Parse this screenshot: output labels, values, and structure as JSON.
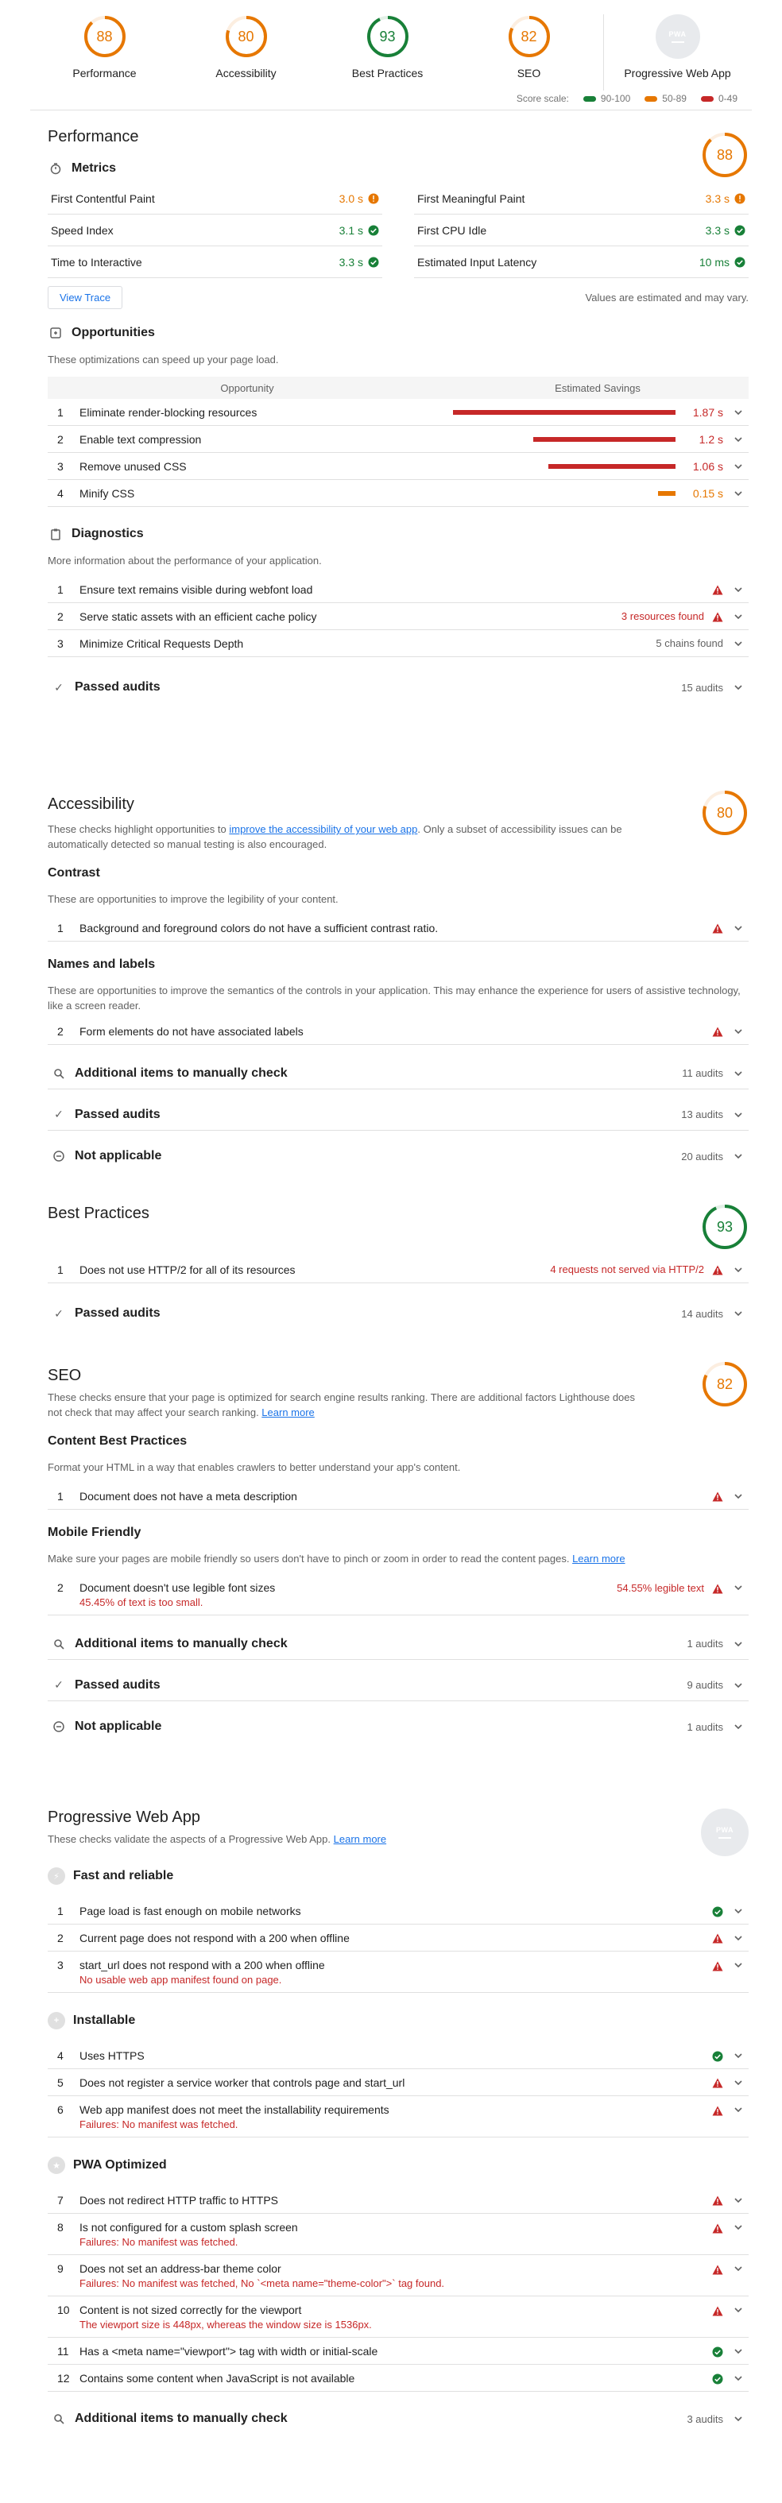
{
  "summary": {
    "categories": [
      {
        "label": "Performance",
        "score": "88",
        "value": 88,
        "color": "#e67700"
      },
      {
        "label": "Accessibility",
        "score": "80",
        "value": 80,
        "color": "#e67700"
      },
      {
        "label": "Best Practices",
        "score": "93",
        "value": 93,
        "color": "#188038"
      },
      {
        "label": "SEO",
        "score": "82",
        "value": 82,
        "color": "#e67700"
      }
    ],
    "pwa": {
      "label": "Progressive Web App",
      "badge": "PWA"
    },
    "scale_label": "Score scale:",
    "scale": [
      {
        "label": "90-100",
        "color": "#188038"
      },
      {
        "label": "50-89",
        "color": "#e67700"
      },
      {
        "label": "0-49",
        "color": "#c62828"
      }
    ]
  },
  "performance": {
    "title": "Performance",
    "score": "88",
    "metrics_title": "Metrics",
    "metrics_left": [
      {
        "label": "First Contentful Paint",
        "value": "3.0 s",
        "status": "average"
      },
      {
        "label": "Speed Index",
        "value": "3.1 s",
        "status": "pass"
      },
      {
        "label": "Time to Interactive",
        "value": "3.3 s",
        "status": "pass"
      }
    ],
    "metrics_right": [
      {
        "label": "First Meaningful Paint",
        "value": "3.3 s",
        "status": "average"
      },
      {
        "label": "First CPU Idle",
        "value": "3.3 s",
        "status": "pass"
      },
      {
        "label": "Estimated Input Latency",
        "value": "10 ms",
        "status": "pass"
      }
    ],
    "view_trace": "View Trace",
    "estimated_note": "Values are estimated and may vary.",
    "opportunities_title": "Opportunities",
    "opportunities_desc": "These optimizations can speed up your page load.",
    "opp_col_opportunity": "Opportunity",
    "opp_col_savings": "Estimated Savings",
    "opportunities": [
      {
        "num": "1",
        "title": "Eliminate render-blocking resources",
        "value": "1.87 s",
        "fraction": 1.0,
        "color": "#c62828"
      },
      {
        "num": "2",
        "title": "Enable text compression",
        "value": "1.2 s",
        "fraction": 0.64,
        "color": "#c62828"
      },
      {
        "num": "3",
        "title": "Remove unused CSS",
        "value": "1.06 s",
        "fraction": 0.57,
        "color": "#c62828"
      },
      {
        "num": "4",
        "title": "Minify CSS",
        "value": "0.15 s",
        "fraction": 0.08,
        "color": "#e67700"
      }
    ],
    "diagnostics_title": "Diagnostics",
    "diagnostics_desc": "More information about the performance of your application.",
    "diagnostics": [
      {
        "num": "1",
        "title": "Ensure text remains visible during webfont load",
        "detail": "",
        "warn": true
      },
      {
        "num": "2",
        "title": "Serve static assets with an efficient cache policy",
        "detail": "3 resources found",
        "warn": true
      },
      {
        "num": "3",
        "title": "Minimize Critical Requests Depth",
        "detail": "5 chains found",
        "warn": false
      }
    ],
    "passed_title": "Passed audits",
    "passed_count": "15 audits"
  },
  "accessibility": {
    "title": "Accessibility",
    "score": "80",
    "desc_pre": "These checks highlight opportunities to ",
    "desc_link": "improve the accessibility of your web app",
    "desc_post": ". Only a subset of accessibility issues can be automatically detected so manual testing is also encouraged.",
    "contrast_title": "Contrast",
    "contrast_desc": "These are opportunities to improve the legibility of your content.",
    "contrast_item": {
      "num": "1",
      "title": "Background and foreground colors do not have a sufficient contrast ratio."
    },
    "names_title": "Names and labels",
    "names_desc": "These are opportunities to improve the semantics of the controls in your application. This may enhance the experience for users of assistive technology, like a screen reader.",
    "names_item": {
      "num": "2",
      "title": "Form elements do not have associated labels"
    },
    "manual_title": "Additional items to manually check",
    "manual_count": "11 audits",
    "passed_title": "Passed audits",
    "passed_count": "13 audits",
    "na_title": "Not applicable",
    "na_count": "20 audits"
  },
  "best_practices": {
    "title": "Best Practices",
    "score": "93",
    "item": {
      "num": "1",
      "title": "Does not use HTTP/2 for all of its resources",
      "detail": "4 requests not served via HTTP/2"
    },
    "passed_title": "Passed audits",
    "passed_count": "14 audits"
  },
  "seo": {
    "title": "SEO",
    "score": "82",
    "desc_pre": "These checks ensure that your page is optimized for search engine results ranking. There are additional factors Lighthouse does not check that may affect your search ranking. ",
    "desc_link": "Learn more",
    "content_title": "Content Best Practices",
    "content_desc": "Format your HTML in a way that enables crawlers to better understand your app's content.",
    "content_item": {
      "num": "1",
      "title": "Document does not have a meta description"
    },
    "mobile_title": "Mobile Friendly",
    "mobile_desc_pre": "Make sure your pages are mobile friendly so users don't have to pinch or zoom in order to read the content pages. ",
    "mobile_desc_link": "Learn more",
    "mobile_item": {
      "num": "2",
      "title": "Document doesn't use legible font sizes",
      "detail": "54.55% legible text",
      "sub": "45.45% of text is too small."
    },
    "manual_title": "Additional items to manually check",
    "manual_count": "1 audits",
    "passed_title": "Passed audits",
    "passed_count": "9 audits",
    "na_title": "Not applicable",
    "na_count": "1 audits"
  },
  "pwa": {
    "title": "Progressive Web App",
    "badge": "PWA",
    "desc_pre": "These checks validate the aspects of a Progressive Web App. ",
    "desc_link": "Learn more",
    "fast_title": "Fast and reliable",
    "fast_items": [
      {
        "num": "1",
        "title": "Page load is fast enough on mobile networks",
        "status": "pass",
        "sub": ""
      },
      {
        "num": "2",
        "title": "Current page does not respond with a 200 when offline",
        "status": "fail",
        "sub": ""
      },
      {
        "num": "3",
        "title": "start_url does not respond with a 200 when offline",
        "status": "fail",
        "sub": "No usable web app manifest found on page."
      }
    ],
    "install_title": "Installable",
    "install_items": [
      {
        "num": "4",
        "title": "Uses HTTPS",
        "status": "pass",
        "sub": ""
      },
      {
        "num": "5",
        "title": "Does not register a service worker that controls page and start_url",
        "status": "fail",
        "sub": ""
      },
      {
        "num": "6",
        "title": "Web app manifest does not meet the installability requirements",
        "status": "fail",
        "sub": "Failures: No manifest was fetched."
      }
    ],
    "opt_title": "PWA Optimized",
    "opt_items": [
      {
        "num": "7",
        "title": "Does not redirect HTTP traffic to HTTPS",
        "status": "fail",
        "sub": ""
      },
      {
        "num": "8",
        "title": "Is not configured for a custom splash screen",
        "status": "fail",
        "sub": "Failures: No manifest was fetched."
      },
      {
        "num": "9",
        "title": "Does not set an address-bar theme color",
        "status": "fail",
        "sub": "Failures: No manifest was fetched, No `<meta name=\"theme-color\">` tag found."
      },
      {
        "num": "10",
        "title": "Content is not sized correctly for the viewport",
        "status": "fail",
        "sub": "The viewport size is 448px, whereas the window size is 1536px."
      },
      {
        "num": "11",
        "title": "Has a <meta name=\"viewport\"> tag with width or initial-scale",
        "status": "pass",
        "sub": ""
      },
      {
        "num": "12",
        "title": "Contains some content when JavaScript is not available",
        "status": "pass",
        "sub": ""
      }
    ],
    "manual_title": "Additional items to manually check",
    "manual_count": "3 audits"
  }
}
